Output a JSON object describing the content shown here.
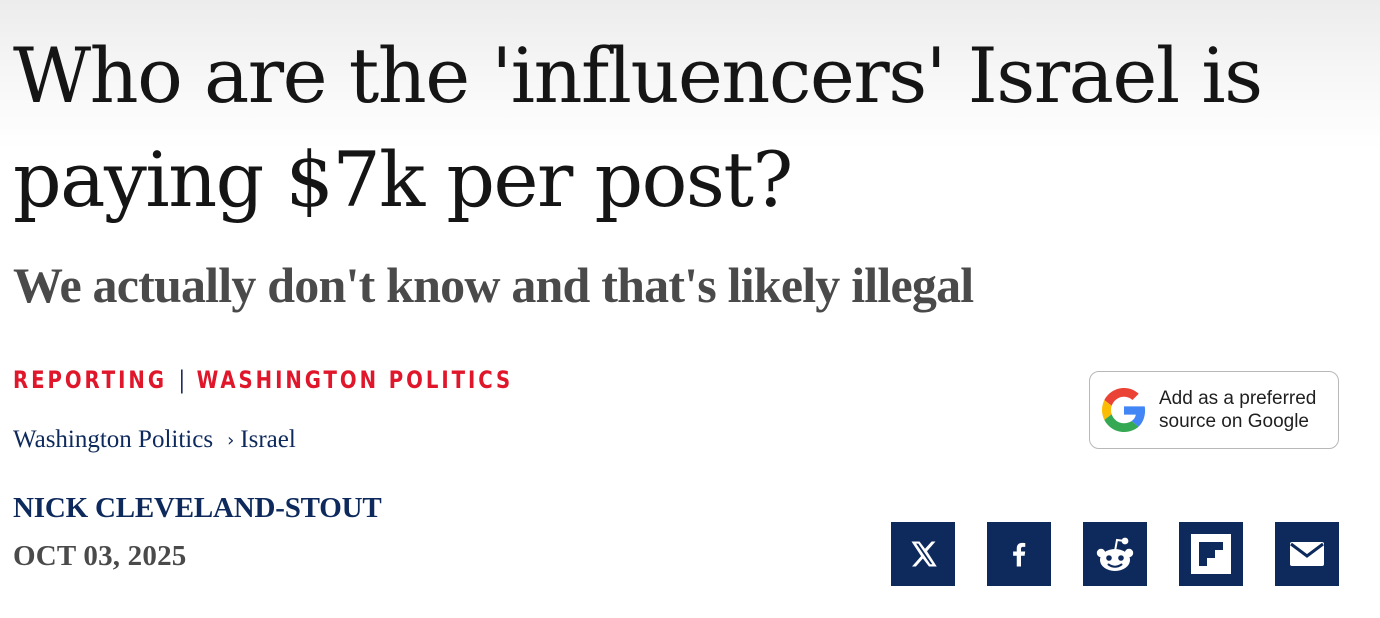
{
  "article": {
    "headline": "Who are the 'influencers' Israel is paying $7k per post?",
    "subhead": "We actually don't know and that's likely illegal",
    "kicker": {
      "primary": "REPORTING",
      "separator": "|",
      "secondary": "WASHINGTON POLITICS"
    },
    "breadcrumb": {
      "parent": "Washington Politics",
      "separator": "›",
      "current": "Israel"
    },
    "author": "NICK CLEVELAND-STOUT",
    "date": "OCT 03, 2025"
  },
  "google_badge": {
    "line1": "Add as a preferred",
    "line2": "source on Google",
    "icon": "google-g-icon"
  },
  "share": [
    {
      "network": "X",
      "icon": "x-icon"
    },
    {
      "network": "Facebook",
      "icon": "facebook-icon"
    },
    {
      "network": "Reddit",
      "icon": "reddit-icon"
    },
    {
      "network": "Flipboard",
      "icon": "flipboard-icon"
    },
    {
      "network": "Email",
      "icon": "email-icon"
    }
  ],
  "colors": {
    "kicker_red": "#e0162b",
    "navy": "#0e2a5c",
    "headline": "#151515",
    "subhead": "#4a4a4a"
  }
}
